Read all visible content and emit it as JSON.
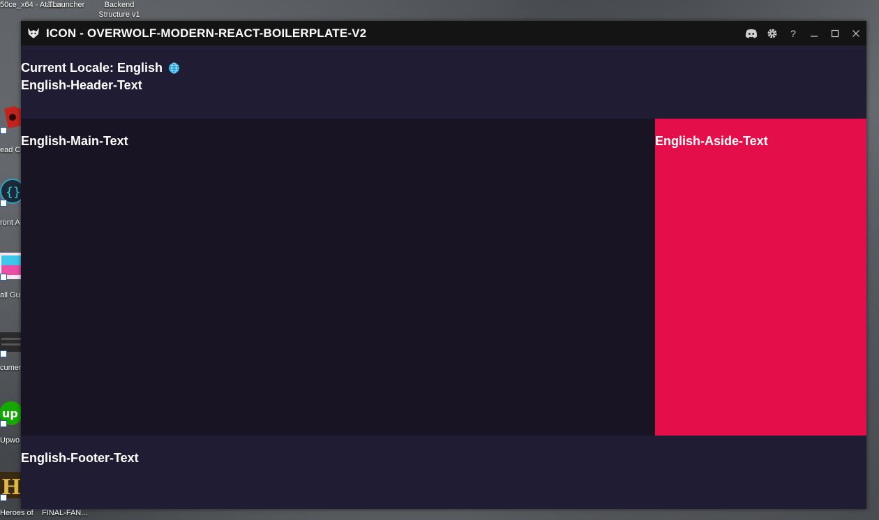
{
  "desktop": {
    "top_labels": [
      "50ce_x64 - Atalho",
      "TLauncher",
      "Backend Structure v1"
    ],
    "side_labels": [
      "ead C",
      "ront A",
      "all Gu",
      "cumen",
      "Upwo",
      "Heroes of"
    ],
    "bottom_labels": [
      "FINAL-FAN..."
    ]
  },
  "window": {
    "title": "ICON - OVERWOLF-MODERN-REACT-BOILERPLATE-V2",
    "controls": {
      "discord": "discord-icon",
      "settings": "gear-icon",
      "help": "?",
      "minimize": "minimize-icon",
      "maximize": "maximize-icon",
      "close": "close-icon"
    }
  },
  "header": {
    "locale_label": "Current Locale: English",
    "header_text": "English-Header-Text"
  },
  "main": {
    "text": "English-Main-Text"
  },
  "aside": {
    "text": "English-Aside-Text",
    "color": "#e40e4a"
  },
  "footer": {
    "text": "English-Footer-Text"
  }
}
